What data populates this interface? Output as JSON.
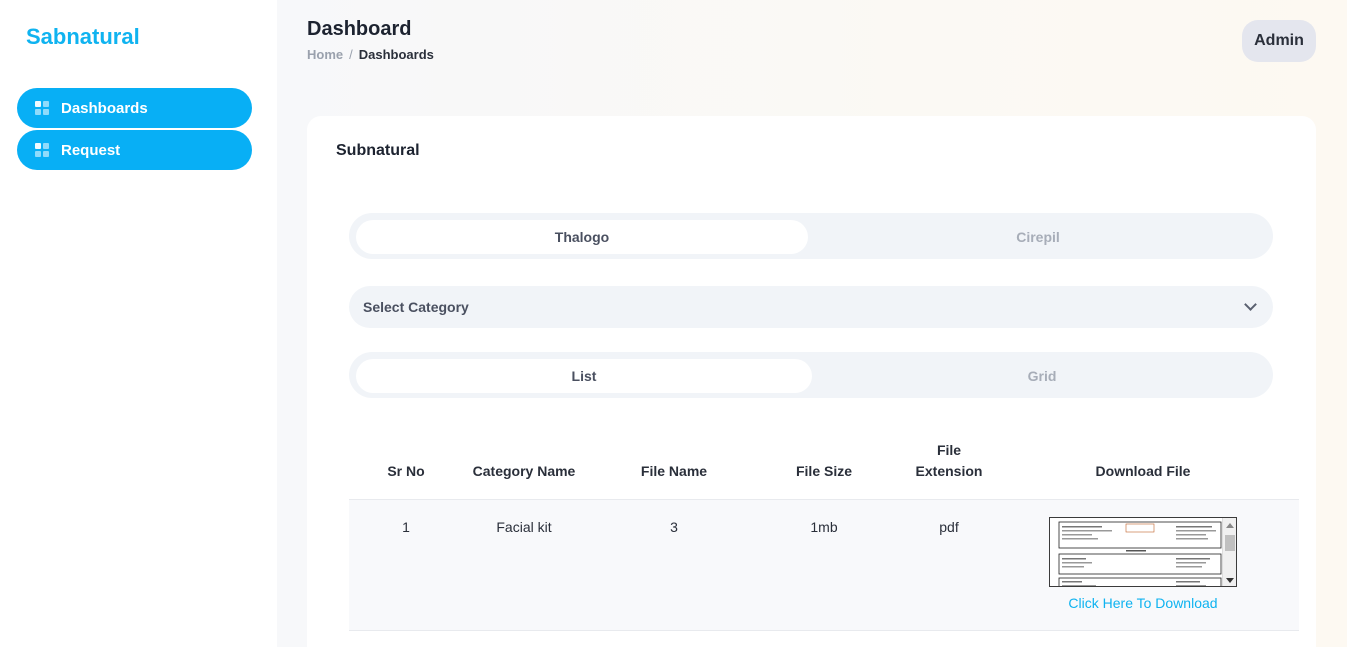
{
  "sidebar": {
    "brand": "Sabnatural",
    "items": [
      {
        "label": "Dashboards",
        "icon": "grid-icon"
      },
      {
        "label": "Request",
        "icon": "grid-icon"
      }
    ]
  },
  "header": {
    "title": "Dashboard",
    "breadcrumb": {
      "home": "Home",
      "separator": "/",
      "current": "Dashboards"
    },
    "user_button": "Admin"
  },
  "card": {
    "title": "Subnatural",
    "brand_tabs": {
      "active": "Thalogo",
      "inactive": "Cirepil"
    },
    "category_select": {
      "value": "Select Category"
    },
    "view_tabs": {
      "active": "List",
      "inactive": "Grid"
    },
    "table": {
      "columns": [
        "Sr No",
        "Category Name",
        "File Name",
        "File Size",
        "File Extension",
        "Download File"
      ],
      "rows": [
        {
          "sr_no": "1",
          "category": "Facial kit",
          "file_name": "3",
          "file_size": "1mb",
          "extension": "pdf",
          "download_label": "Click Here To Download"
        }
      ]
    }
  },
  "colors": {
    "accent": "#08aff5",
    "brand_text": "#0fb3f0",
    "card_bg": "#ffffff",
    "segment_bg": "#f1f4f8"
  }
}
